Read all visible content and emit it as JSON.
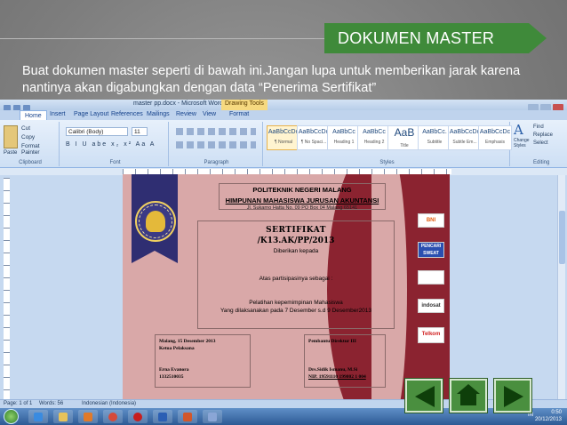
{
  "slide": {
    "title": "DOKUMEN MASTER",
    "instruction": "Buat dokumen master seperti di bawah ini.Jangan lupa untuk memberikan jarak karena nantinya akan digabungkan dengan data “Penerima Sertifikat”",
    "colors": {
      "banner": "#3f8a3a",
      "background": "#7d7d7d",
      "nav_button": "#4a8f3f"
    }
  },
  "word": {
    "window_title": "master pp.docx - Microsoft Word",
    "contextual_tab": "Drawing Tools",
    "tabs": [
      "Home",
      "Insert",
      "Page Layout",
      "References",
      "Mailings",
      "Review",
      "View",
      "Format"
    ],
    "clipboard": {
      "paste": "Paste",
      "cut": "Cut",
      "copy": "Copy",
      "format_painter": "Format Painter",
      "label": "Clipboard"
    },
    "font": {
      "name": "Calibri (Body)",
      "size": "11",
      "label": "Font"
    },
    "paragraph_label": "Paragraph",
    "styles": [
      {
        "sample": "AaBbCcDc",
        "name": "¶ Normal"
      },
      {
        "sample": "AaBbCcDc",
        "name": "¶ No Spaci..."
      },
      {
        "sample": "AaBbCc",
        "name": "Heading 1"
      },
      {
        "sample": "AaBbCc",
        "name": "Heading 2"
      },
      {
        "sample": "AaB",
        "name": "Title"
      },
      {
        "sample": "AaBbCc.",
        "name": "Subtitle"
      },
      {
        "sample": "AaBbCcDc",
        "name": "Subtle Em..."
      },
      {
        "sample": "AaBbCcDc",
        "name": "Emphasis"
      }
    ],
    "styles_label": "Styles",
    "change_styles": "Change Styles",
    "editing": {
      "find": "Find",
      "replace": "Replace",
      "select": "Select",
      "label": "Editing"
    },
    "status": {
      "page": "Page: 1 of 1",
      "words": "Words: 56",
      "language": "Indonesian (Indonesia)"
    },
    "tray": {
      "time": "0:50",
      "date": "20/12/2013",
      "lang": "IN"
    }
  },
  "certificate": {
    "institution": "POLITEKNIK NEGERI MALANG",
    "association": "HIMPUNAN MAHASISWA JURUSAN AKUNTANSI",
    "address": "Jl. Sukarno Hatta No. 09 PO Box 04 Malang 65141",
    "heading": "SERTIFIKAT",
    "number": "/K13.AK/PP/2013",
    "given_to": "Diberikan kepada",
    "participation": "Atas partisipasinya  sebagai  :",
    "event": "Pelatihan kepemimpinan Mahasiswa",
    "event_date": "Yang dilaksanakan pada 7 Desember s.d 9 Desember2013",
    "left_sig": {
      "place_date": "Malang, 15 Desember 2013",
      "role": "Ketua Pelaksana",
      "name": "Erna Evanora",
      "id": "1332510035"
    },
    "right_sig": {
      "role": "Pembantu Direktur III",
      "name": "Drs.Sidik Ismanu, M.Si",
      "nip": "NIP. 19591110 199802 1 004"
    },
    "sponsors": [
      "BNI",
      "PENCARI SWEAT",
      "",
      "indosat",
      "Telkom"
    ],
    "colors": {
      "page": "#d9a8a8",
      "accent": "#8b2330",
      "seal_ribbon": "#2f2e72"
    }
  }
}
